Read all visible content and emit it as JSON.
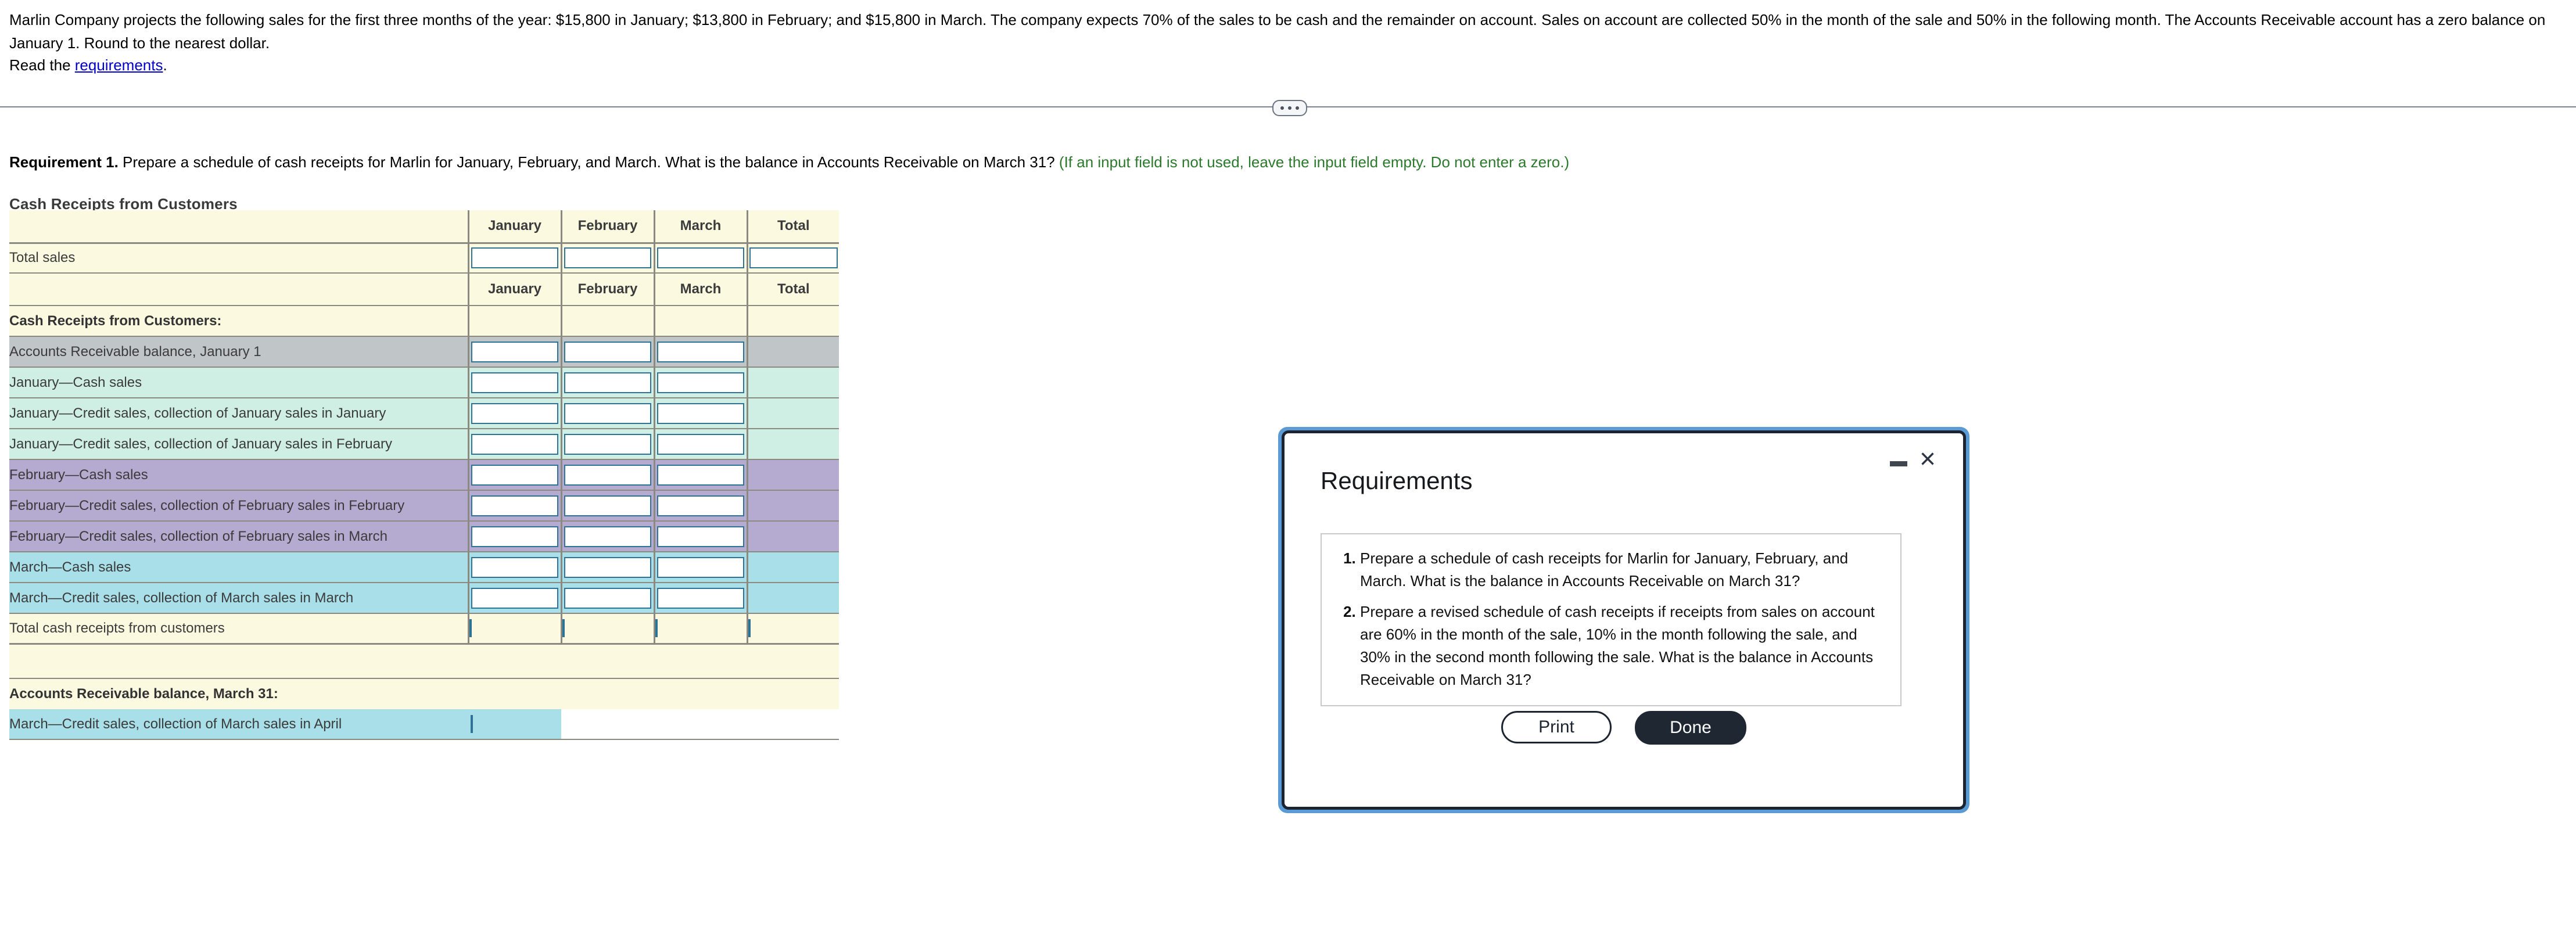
{
  "problem": {
    "statement": "Marlin Company projects the following sales for the first three months of the year: $15,800 in January; $13,800 in February; and $15,800 in March. The company expects 70% of the sales to be cash and the remainder on account. Sales on account are collected 50% in the month of the sale and 50% in the following month. The Accounts Receivable account has a zero balance on January 1. Round to the nearest dollar.",
    "read_prefix": "Read the ",
    "read_link": "requirements",
    "read_suffix": "."
  },
  "requirement": {
    "label": "Requirement 1.",
    "text": " Prepare a schedule of cash receipts for Marlin for January, February, and March. What is the balance in Accounts Receivable on March 31? ",
    "hint": "(If an input field is not used, leave the input field empty. Do not enter a zero.)"
  },
  "schedule": {
    "title": "Cash Receipts from Customers",
    "columns": [
      "January",
      "February",
      "March",
      "Total"
    ],
    "total_sales_label": "Total sales",
    "section_label": "Cash Receipts from Customers:",
    "rows": [
      {
        "label": "Accounts Receivable balance, January 1",
        "color": "gray"
      },
      {
        "label": "January—Cash sales",
        "color": "mint"
      },
      {
        "label": "January—Credit sales, collection of January sales in January",
        "color": "mint"
      },
      {
        "label": "January—Credit sales, collection of January sales in February",
        "color": "mint"
      },
      {
        "label": "February—Cash sales",
        "color": "purp"
      },
      {
        "label": "February—Credit sales, collection of February sales in February",
        "color": "purp"
      },
      {
        "label": "February—Credit sales, collection of February sales in March",
        "color": "purp"
      },
      {
        "label": "March—Cash sales",
        "color": "cyan"
      },
      {
        "label": "March—Credit sales, collection of March sales in March",
        "color": "cyan"
      }
    ],
    "total_receipts_label": "Total cash receipts from customers",
    "ar_balance_label": "Accounts Receivable balance, March 31:",
    "ar_row_label": "March—Credit sales, collection of March sales in April"
  },
  "dialog": {
    "title": "Requirements",
    "items": [
      "Prepare a schedule of cash receipts for Marlin for January, February, and March. What is the balance in Accounts Receivable on March 31?",
      "Prepare a revised schedule of cash receipts if receipts from sales on account are 60% in the month of the sale, 10% in the month following the sale, and 30% in the second month following the sale. What is the balance in Accounts Receivable on March 31?"
    ],
    "print_label": "Print",
    "done_label": "Done",
    "close_glyph": "×"
  },
  "colors": {
    "cream": "#fbfae0",
    "gray": "#c0c5c7",
    "mint": "#cfeee4",
    "purple": "#b5aacf",
    "cyan": "#a8dfe8",
    "input_border": "#2e7296",
    "hint_green": "#2b7a2b",
    "link_blue": "#0000cc"
  }
}
